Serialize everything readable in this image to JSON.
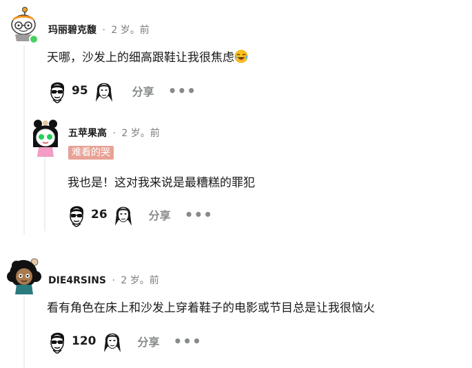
{
  "comments": [
    {
      "username": "玛丽碧克馥",
      "dot": "·",
      "age": "2 岁。前",
      "text": "天哪，沙发上的细高跟鞋让我很焦虑",
      "emoji": "laughing-crying-face-icon",
      "votes": "95",
      "share_label": "分享",
      "more_label": "•••",
      "online": true
    },
    {
      "username": "五苹果高",
      "dot": "·",
      "age": "2 岁。前",
      "flair": "难看的哭",
      "text": "我也是！这对我来说是最糟糕的罪犯",
      "votes": "26",
      "share_label": "分享",
      "more_label": "•••"
    },
    {
      "username": "DIE4RSINS",
      "dot": "·",
      "age": "2 岁。前",
      "text": "看有角色在床上和沙发上穿着鞋子的电影或节目总是让我很恼火",
      "votes": "120",
      "share_label": "分享",
      "more_label": "•••"
    }
  ],
  "colors": {
    "flair_bg": "#e8a296",
    "online": "#46d160",
    "thread_line": "#edeff1",
    "action_gray": "#878a8c"
  }
}
